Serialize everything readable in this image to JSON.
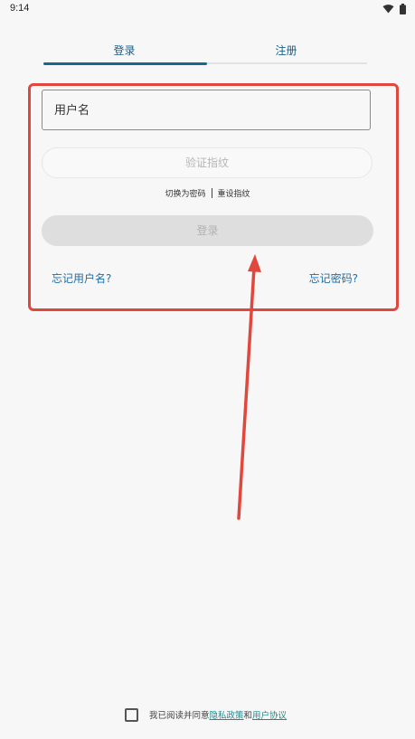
{
  "status_bar": {
    "time": "9:14",
    "icons": [
      "wifi-icon",
      "battery-icon"
    ]
  },
  "tabs": [
    {
      "label": "登录",
      "active": true
    },
    {
      "label": "注册",
      "active": false
    }
  ],
  "form": {
    "username_placeholder": "用户名",
    "fingerprint_label": "验证指纹",
    "switch_password": "切换为密码",
    "reset_fingerprint": "重设指纹",
    "login_label": "登录",
    "forgot_username": "忘记用户名?",
    "forgot_password": "忘记密码?"
  },
  "agreement": {
    "prefix": "我已阅读并同意",
    "privacy_policy": "隐私政策",
    "conjunction": "和",
    "user_agreement": "用户协议",
    "checked": false
  },
  "colors": {
    "accent": "#17688f",
    "link": "#1f6fa8",
    "annotation": "#e2473d",
    "background": "#f7f7f7"
  }
}
